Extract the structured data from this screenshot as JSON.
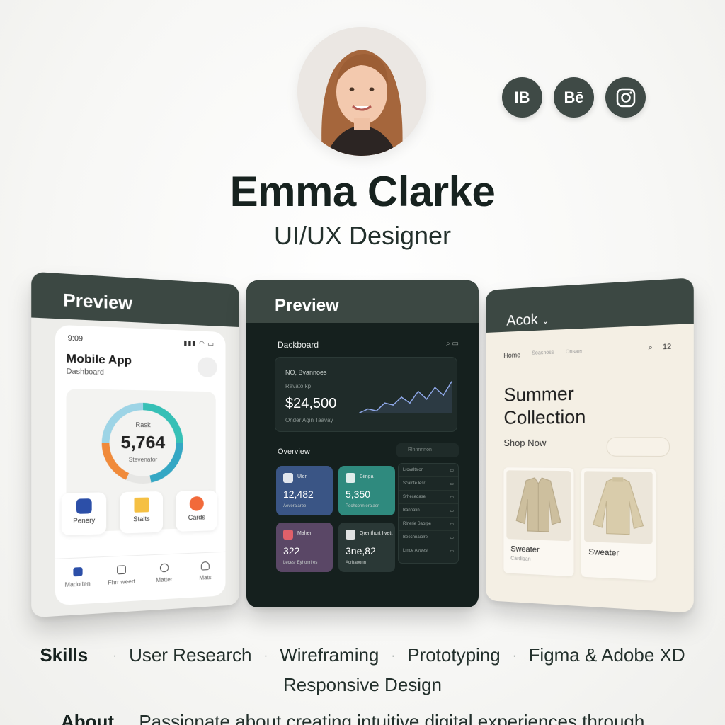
{
  "profile": {
    "name": "Emma Clarke",
    "role": "UI/UX Designer"
  },
  "socials": [
    {
      "label": "IB",
      "icon": "blog-icon"
    },
    {
      "label": "Bē",
      "icon": "behance-icon"
    },
    {
      "label": "",
      "icon": "instagram-icon"
    }
  ],
  "cards": {
    "left": {
      "header": "Preview",
      "time": "9:09",
      "app_title": "Mobile App",
      "app_sub": "Dashboard",
      "gauge_label": "Rask",
      "gauge_value": "5,764",
      "gauge_sub": "Stevenator",
      "quick": [
        "Penery",
        "Stalts",
        "Cards"
      ],
      "tabs": [
        "Madoiten",
        "Fhrr weert",
        "Matter",
        "Mats"
      ]
    },
    "mid": {
      "header": "Preview",
      "title": "Dackboard",
      "revenue_label": "NO, Bvannoes",
      "revenue_sub": "Ravato kp",
      "revenue_value": "$24,500",
      "revenue_note": "Onder Agin Taavay",
      "overview_title": "Overview",
      "search_placeholder": "Rlnnnnnon",
      "tiles": [
        {
          "label": "Uler",
          "value": "12,482",
          "sub": "Aeveralarbe",
          "color": "#3a5585"
        },
        {
          "label": "Biinga",
          "value": "5,350",
          "sub": "Pechconn eraiaer",
          "color": "#2f8a7e"
        },
        {
          "label": "Maher",
          "value": "322",
          "sub": "Lecesr Eyhonrires",
          "color": "#5a4766"
        },
        {
          "label": "Qrenthort Iivett",
          "value": "3ne,82",
          "sub": "Acrhaoonn",
          "color": "#2a3836"
        }
      ],
      "list": [
        "Lrovaltsion",
        "Scaldte lesr",
        "Srhecedase",
        "Bannatin",
        "Rlnerie Saorpe",
        "Beechriaiolre",
        "Lrnoe Avwest"
      ]
    },
    "right": {
      "header": "Acok",
      "nav": [
        "Home",
        "Soasnoss",
        "Onsaer"
      ],
      "cart_count": "12",
      "heading_line1": "Summer",
      "heading_line2": "Collection",
      "cta": "Shop Now",
      "products": [
        {
          "name": "Sweater",
          "sub": "Cardigan"
        },
        {
          "name": "Sweater",
          "sub": ""
        }
      ]
    }
  },
  "skills": {
    "label": "Skills",
    "items": [
      "User Research",
      "Wireframing",
      "Prototyping",
      "Figma & Adobe XD"
    ],
    "extra": "Responsive Design"
  },
  "about": {
    "label": "About",
    "text": "Passionate about creating intuitive digital experiences through"
  },
  "chart_data": {
    "type": "line",
    "x": [
      1,
      2,
      3,
      4,
      5,
      6,
      7,
      8,
      9,
      10,
      11,
      12
    ],
    "values": [
      30,
      34,
      32,
      40,
      38,
      46,
      40,
      52,
      44,
      56,
      48,
      62
    ]
  }
}
